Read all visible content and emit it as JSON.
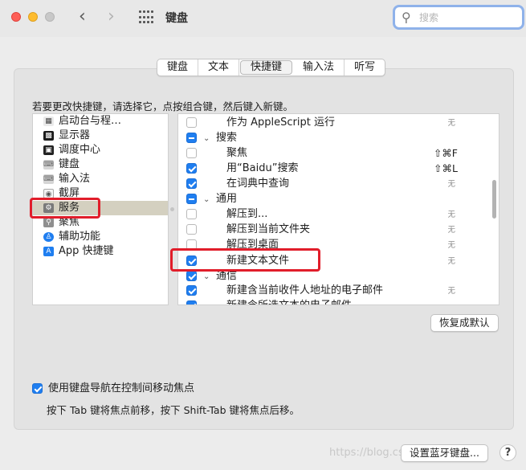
{
  "window": {
    "title": "键盘",
    "search_placeholder": "搜索",
    "back_glyph": "‹",
    "forward_glyph": "›"
  },
  "tabs": [
    {
      "label": "键盘",
      "active": false
    },
    {
      "label": "文本",
      "active": false
    },
    {
      "label": "快捷键",
      "active": true
    },
    {
      "label": "输入法",
      "active": false
    },
    {
      "label": "听写",
      "active": false
    }
  ],
  "instruction": "若要更改快捷键，请选择它，点按组合键，然后键入新键。",
  "categories": [
    {
      "label": "启动台与程…",
      "icon": "launchpad-icon",
      "color": "#555555"
    },
    {
      "label": "显示器",
      "icon": "display-icon",
      "color": "#1a1a1a"
    },
    {
      "label": "调度中心",
      "icon": "mission-control-icon",
      "color": "#222222"
    },
    {
      "label": "键盘",
      "icon": "keyboard-icon",
      "color": "#bdbdbd"
    },
    {
      "label": "输入法",
      "icon": "input-source-icon",
      "color": "#bdbdbd"
    },
    {
      "label": "截屏",
      "icon": "screenshot-icon",
      "color": "#999999"
    },
    {
      "label": "服务",
      "icon": "gear-icon",
      "color": "#7a7a7a",
      "selected": true
    },
    {
      "label": "聚焦",
      "icon": "spotlight-icon",
      "color": "#8f8f8f"
    },
    {
      "label": "辅助功能",
      "icon": "accessibility-icon",
      "color": "#1f7ef0"
    },
    {
      "label": "App 快捷键",
      "icon": "app-store-icon",
      "color": "#1f7ef0"
    }
  ],
  "shortcuts": [
    {
      "kind": "item",
      "checked": false,
      "label": "作为 AppleScript 运行",
      "key": "无"
    },
    {
      "kind": "group",
      "state": "mixed",
      "label": "搜索"
    },
    {
      "kind": "item",
      "checked": false,
      "label": "聚焦",
      "key": "⇧⌘F"
    },
    {
      "kind": "item",
      "checked": true,
      "label": "用“Baidu”搜索",
      "key": "⇧⌘L"
    },
    {
      "kind": "item",
      "checked": true,
      "label": "在词典中查询",
      "key": "无"
    },
    {
      "kind": "group",
      "state": "mixed",
      "label": "通用"
    },
    {
      "kind": "item",
      "checked": false,
      "label": "解压到...",
      "key": "无"
    },
    {
      "kind": "item",
      "checked": false,
      "label": "解压到当前文件夹",
      "key": "无"
    },
    {
      "kind": "item",
      "checked": false,
      "label": "解压到桌面",
      "key": "无"
    },
    {
      "kind": "item",
      "checked": true,
      "label": "新建文本文件",
      "key": "无"
    },
    {
      "kind": "group",
      "state": "checked",
      "label": "通信"
    },
    {
      "kind": "item",
      "checked": true,
      "label": "新建含当前收件人地址的电子邮件",
      "key": "无"
    },
    {
      "kind": "item",
      "checked": true,
      "label": "新建含所选文本的电子邮件",
      "key": ""
    }
  ],
  "restore_button": "恢复成默认",
  "keyboard_nav": {
    "checked": true,
    "label": "使用键盘导航在控制间移动焦点",
    "hint": "按下 Tab 键将焦点前移，按下 Shift-Tab 键将焦点后移。"
  },
  "bluetooth_button": "设置蓝牙键盘...",
  "help_glyph": "?",
  "watermark": "https://blog.csdn.net/kyoyu",
  "colors": {
    "accent": "#1f7ef0",
    "highlight_box": "#e11d2a",
    "selected_row": "#d4d0c0"
  }
}
